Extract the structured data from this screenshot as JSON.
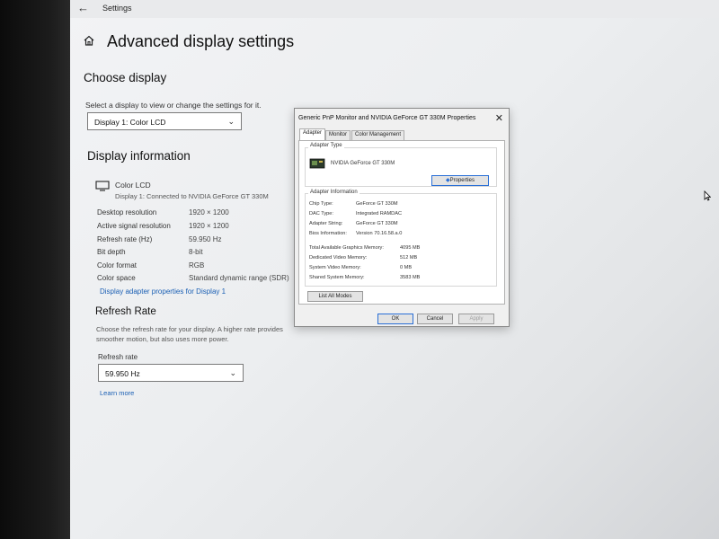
{
  "window": {
    "back_glyph": "←",
    "app_title": "Settings"
  },
  "page": {
    "title": "Advanced display settings"
  },
  "choose_display": {
    "heading": "Choose display",
    "instruction": "Select a display to view or change the settings for it.",
    "selected": "Display 1: Color LCD"
  },
  "display_info": {
    "heading": "Display information",
    "monitor_name": "Color LCD",
    "connection": "Display 1: Connected to NVIDIA GeForce GT 330M",
    "rows": [
      {
        "label": "Desktop resolution",
        "value": "1920 × 1200"
      },
      {
        "label": "Active signal resolution",
        "value": "1920 × 1200"
      },
      {
        "label": "Refresh rate (Hz)",
        "value": "59.950 Hz"
      },
      {
        "label": "Bit depth",
        "value": "8-bit"
      },
      {
        "label": "Color format",
        "value": "RGB"
      },
      {
        "label": "Color space",
        "value": "Standard dynamic range (SDR)"
      }
    ],
    "adapter_link": "Display adapter properties for Display 1"
  },
  "refresh": {
    "heading": "Refresh Rate",
    "desc_line1": "Choose the refresh rate for your display. A higher rate provides",
    "desc_line2": "smoother motion, but also uses more power.",
    "label": "Refresh rate",
    "selected": "59.950 Hz",
    "learn_more": "Learn more"
  },
  "dialog": {
    "title": "Generic PnP Monitor and NVIDIA GeForce GT 330M  Properties",
    "close_glyph": "✕",
    "tabs": [
      "Adapter",
      "Monitor",
      "Color Management"
    ],
    "adapter_type_label": "Adapter Type",
    "adapter_name": "NVIDIA GeForce GT 330M",
    "properties_btn": "Properties",
    "adapter_info_label": "Adapter Information",
    "info": [
      {
        "label": "Chip Type:",
        "value": "GeForce GT 330M"
      },
      {
        "label": "DAC Type:",
        "value": "Integrated RAMDAC"
      },
      {
        "label": "Adapter String:",
        "value": "GeForce GT 330M"
      },
      {
        "label": "Bios Information:",
        "value": "Version 70.16.58.a.0"
      }
    ],
    "memory": [
      {
        "label": "Total Available Graphics Memory:",
        "value": "4095 MB"
      },
      {
        "label": "Dedicated Video Memory:",
        "value": "512 MB"
      },
      {
        "label": "System Video Memory:",
        "value": "0 MB"
      },
      {
        "label": "Shared System Memory:",
        "value": "3583 MB"
      }
    ],
    "list_modes_btn": "List All Modes",
    "ok_btn": "OK",
    "cancel_btn": "Cancel",
    "apply_btn": "Apply"
  },
  "colors": {
    "link": "#1a5fb4",
    "accent": "#2a6fd6"
  }
}
